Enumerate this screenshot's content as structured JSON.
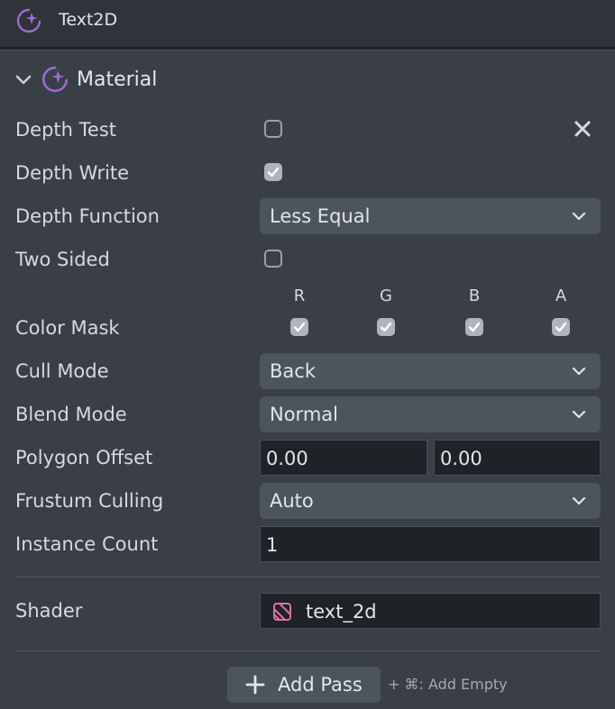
{
  "header": {
    "title": "Text2D",
    "icon": "sparkle-moon-icon"
  },
  "section": {
    "title": "Material",
    "icon": "sparkle-moon-icon",
    "expanded": true
  },
  "accent": "#9b6bd6",
  "fields": {
    "depth_test": {
      "label": "Depth Test",
      "checked": false
    },
    "depth_write": {
      "label": "Depth Write",
      "checked": true
    },
    "depth_function": {
      "label": "Depth Function",
      "value": "Less Equal"
    },
    "two_sided": {
      "label": "Two Sided",
      "checked": false
    },
    "color_mask": {
      "label": "Color Mask",
      "channels": [
        {
          "name": "R",
          "checked": true
        },
        {
          "name": "G",
          "checked": true
        },
        {
          "name": "B",
          "checked": true
        },
        {
          "name": "A",
          "checked": true
        }
      ]
    },
    "cull_mode": {
      "label": "Cull Mode",
      "value": "Back"
    },
    "blend_mode": {
      "label": "Blend Mode",
      "value": "Normal"
    },
    "polygon_offset": {
      "label": "Polygon Offset",
      "factor": "0.00",
      "units": "0.00"
    },
    "frustum_culling": {
      "label": "Frustum Culling",
      "value": "Auto"
    },
    "instance_count": {
      "label": "Instance Count",
      "value": "1"
    },
    "shader": {
      "label": "Shader",
      "value": "text_2d",
      "icon": "shader-asset-icon"
    }
  },
  "actions": {
    "add_pass": "Add Pass",
    "add_empty_hint": "+ ⌘: Add Empty"
  }
}
